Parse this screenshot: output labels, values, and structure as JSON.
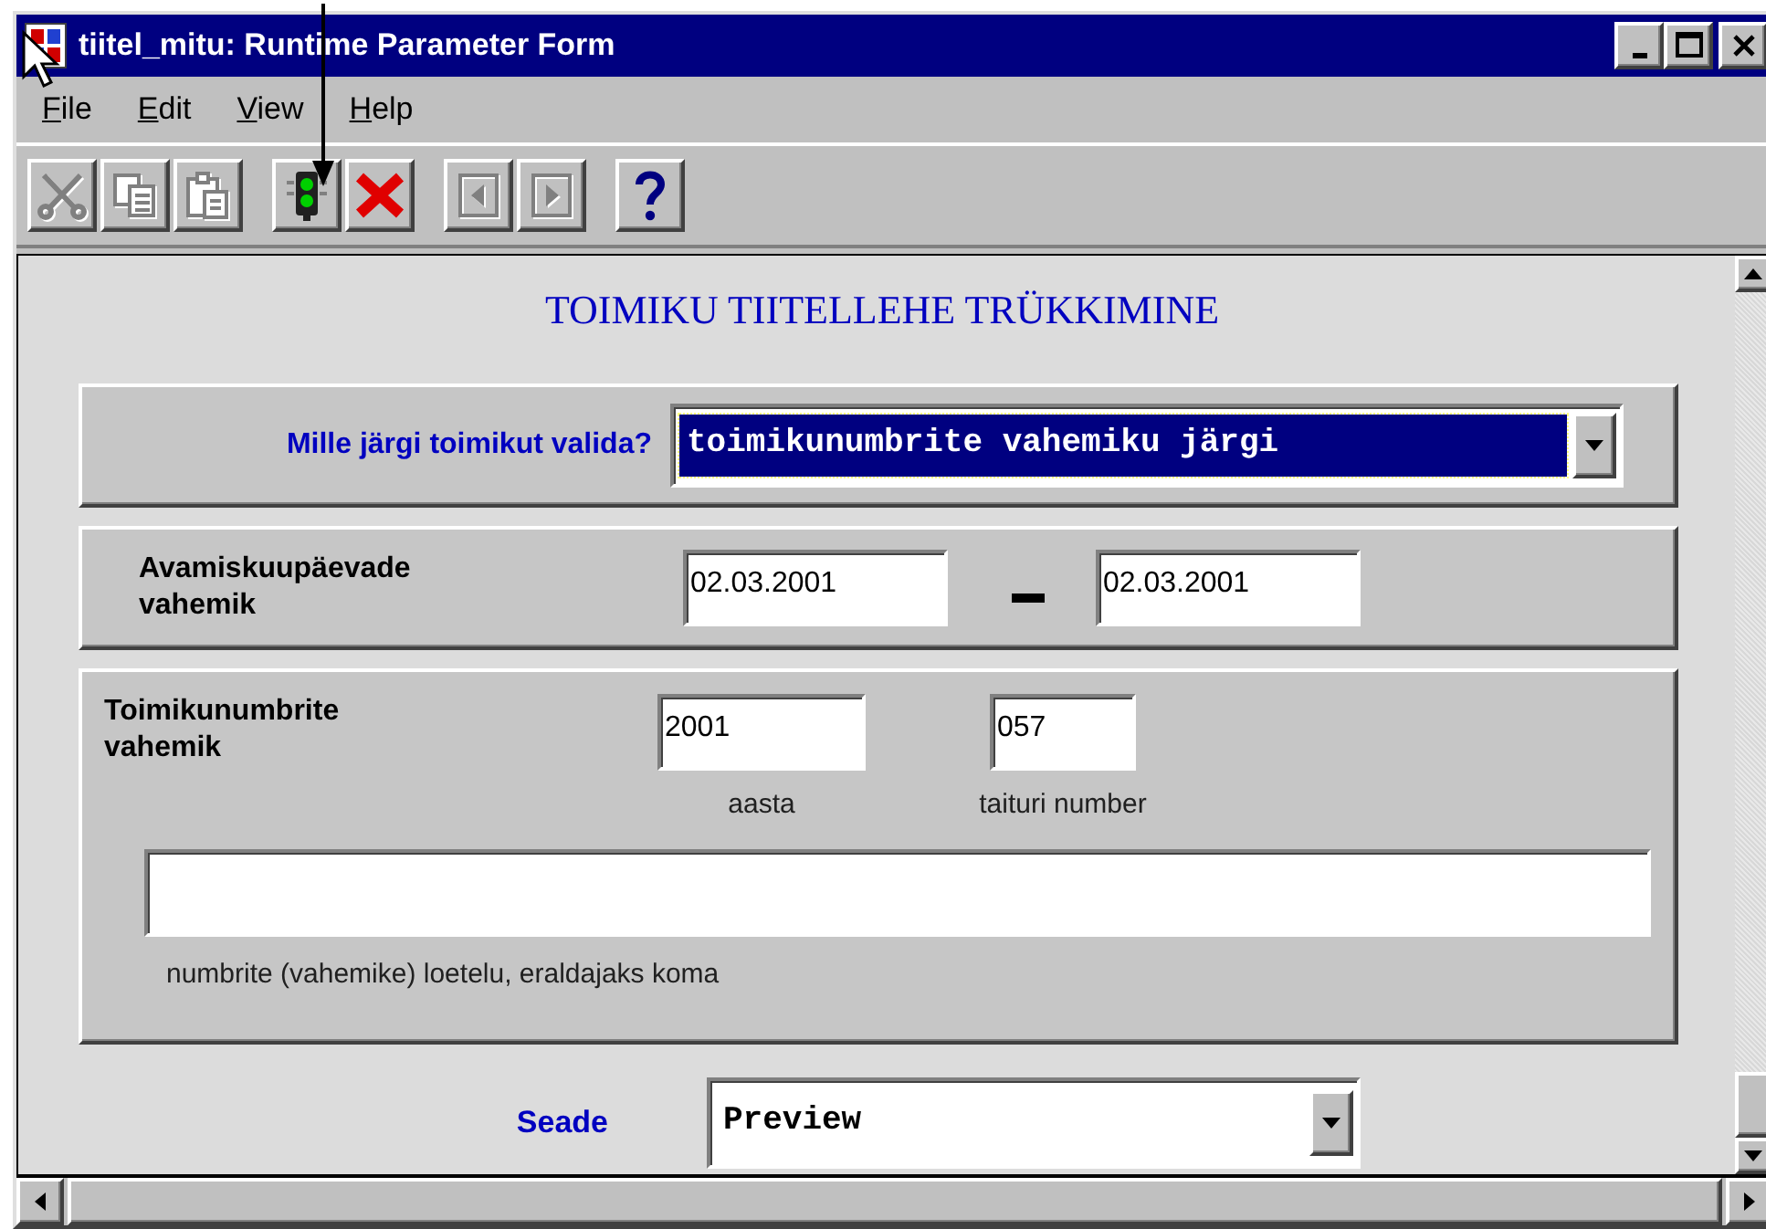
{
  "window": {
    "title": "tiitel_mitu: Runtime Parameter Form"
  },
  "menu": [
    "File",
    "Edit",
    "View",
    "Help"
  ],
  "toolbar": [
    {
      "kind": "cut",
      "disabled": true
    },
    {
      "kind": "copy",
      "disabled": true
    },
    {
      "kind": "paste",
      "disabled": true
    },
    {
      "kind": "run",
      "disabled": false
    },
    {
      "kind": "cancel",
      "disabled": false
    },
    {
      "kind": "previous",
      "disabled": true
    },
    {
      "kind": "next",
      "disabled": true
    },
    {
      "kind": "help",
      "disabled": false
    }
  ],
  "form": {
    "heading": "TOIMIKU TIITELLEHE TRÜKKIMINE",
    "selection": {
      "label": "Mille järgi toimikut valida?",
      "value": "toimikunumbrite vahemiku järgi",
      "selected": true
    },
    "date_range": {
      "label": "Avamiskuupäevade vahemik",
      "from": "02.03.2001",
      "to": "02.03.2001"
    },
    "number_range": {
      "label": "Toimikunumbrite vahemik",
      "year": {
        "value": "2001",
        "caption": "aasta"
      },
      "number": {
        "value": "057",
        "caption": "taituri number"
      },
      "list": {
        "caption": "numbrite (vahemike) loetelu, eraldajaks koma"
      }
    },
    "device": {
      "label": "Seade",
      "value": "Preview"
    }
  }
}
